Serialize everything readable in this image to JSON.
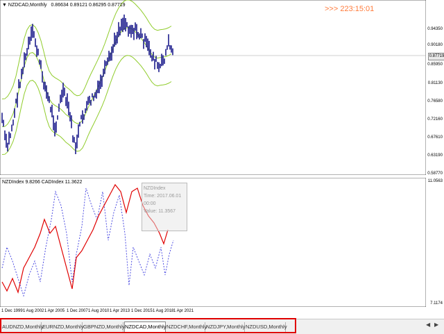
{
  "main_chart": {
    "symbol_header": "NZDCAD,Monthly",
    "ohlc": "0.86634 0.89121 0.86295 0.87719",
    "countdown": ">>> 223:15:01",
    "current_price": "0.87719",
    "price_ticks": [
      "0.94350",
      "0.90180",
      "0.85950",
      "0.81130",
      "0.76580",
      "0.72160",
      "0.67610",
      "0.63190",
      "0.58770"
    ]
  },
  "indicator": {
    "header": "NZDIndex 9.8266  CADIndex 11.3622",
    "top_value": "11.0563",
    "bottom_value": "7.1174",
    "tooltip_title": "NZDIndex",
    "tooltip_lines": [
      "Time: 2017.06.01 00:00",
      "Value: 11.3567"
    ]
  },
  "time_axis": [
    "1 Dec 1999",
    "1 Aug 2002",
    "1 Apr 2005",
    "1 Dec 2007",
    "1 Aug 2010",
    "1 Apr 2013",
    "1 Dec 2015",
    "1 Aug 2018",
    "1 Apr 2021"
  ],
  "tabs": [
    {
      "label": "AUDNZD,Monthly",
      "active": false
    },
    {
      "label": "EURNZD,Monthly",
      "active": false
    },
    {
      "label": "GBPNZD,Monthly",
      "active": false
    },
    {
      "label": "NZDCAD,Monthly",
      "active": true
    },
    {
      "label": "NZDCHF,Monthly",
      "active": false
    },
    {
      "label": "NZDJPY,Monthly",
      "active": false
    },
    {
      "label": "NZDUSD,Monthly",
      "active": false
    }
  ],
  "colors": {
    "bars": "#1c1c8c",
    "envelope": "#8fcc2a",
    "nzd_line": "#e00000",
    "cad_line": "#3a3adf",
    "highlight": "#e00000",
    "countdown": "#ff7a3a"
  }
}
